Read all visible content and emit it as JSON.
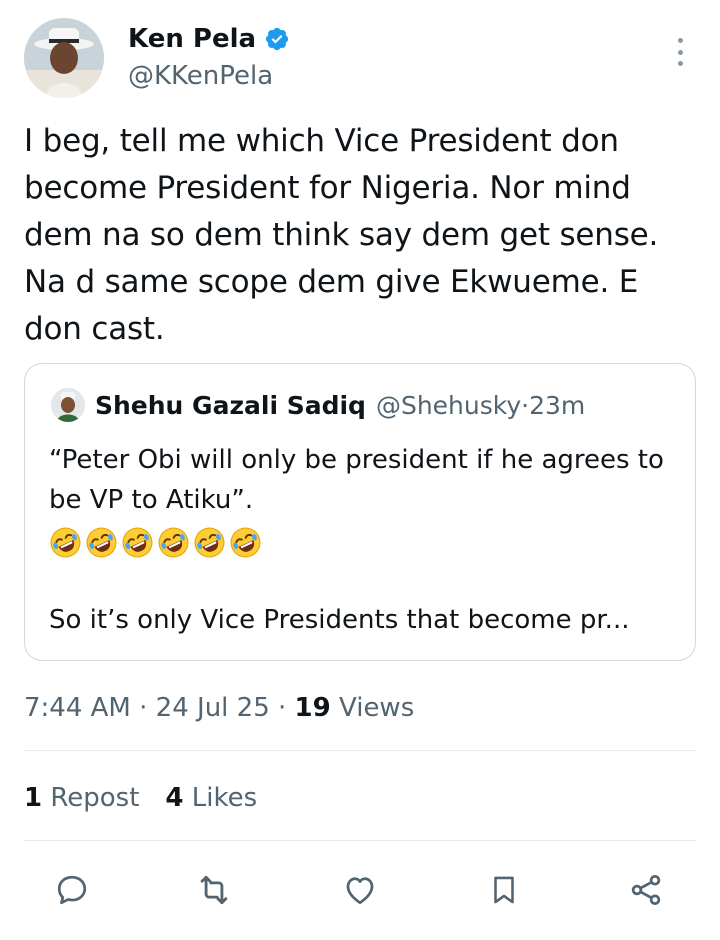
{
  "author": {
    "display_name": "Ken Pela",
    "handle": "@KKenPela",
    "verified": true
  },
  "tweet": {
    "text": "I beg, tell me which Vice President don become President for Nigeria. Nor mind dem na so dem think say dem get sense. Na d same scope dem give Ekwueme. E don cast."
  },
  "quote": {
    "display_name": "Shehu Gazali Sadiq",
    "handle": "@Shehusky",
    "separator": " · ",
    "time": "23m",
    "text_line1": "“Peter Obi will only be president if he agrees to be VP to Atiku”.",
    "emoji_count": 6,
    "text_line2": "So it’s only Vice Presidents that become pr..."
  },
  "meta": {
    "time": "7:44 AM",
    "sep1": " · ",
    "date": "24 Jul 25",
    "sep2": " · ",
    "views_count": "19",
    "views_label": " Views"
  },
  "stats": {
    "reposts_count": "1",
    "reposts_label": " Repost",
    "likes_count": "4",
    "likes_label": " Likes"
  },
  "icons": {
    "more": "more-vertical-icon",
    "reply": "reply-icon",
    "repost": "repost-icon",
    "like": "heart-icon",
    "bookmark": "bookmark-icon",
    "share": "share-icon",
    "emoji": "rolling-on-floor-laughing-emoji"
  },
  "colors": {
    "verified_blue": "#1d9bf0",
    "text_primary": "#0f1419",
    "text_secondary": "#536471",
    "icon_gray": "#536471",
    "border": "#cfd9de"
  }
}
